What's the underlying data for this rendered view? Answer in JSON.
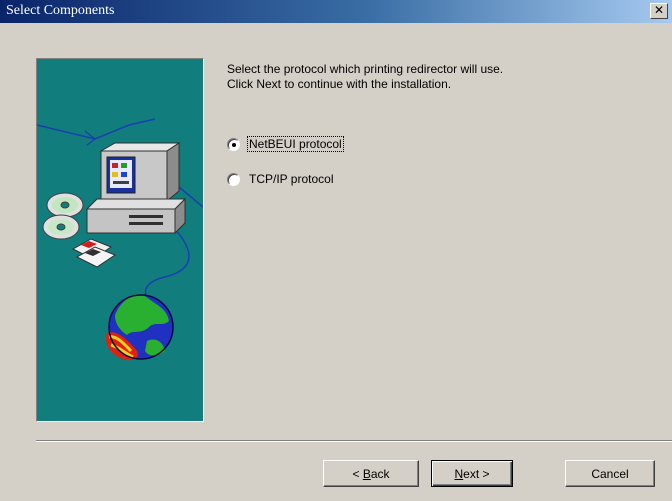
{
  "window": {
    "title": "Select Components",
    "close_glyph": "✕"
  },
  "content": {
    "line1": "Select the protocol which printing redirector will use.",
    "line2": "Click Next to continue with the installation."
  },
  "options": [
    {
      "label": "NetBEUI protocol",
      "selected": true,
      "focused": true
    },
    {
      "label": "TCP/IP protocol",
      "selected": false,
      "focused": false
    }
  ],
  "buttons": {
    "back": {
      "pre": "< ",
      "mnemonic": "B",
      "post": "ack"
    },
    "next": {
      "pre": "",
      "mnemonic": "N",
      "post": "ext >"
    },
    "cancel": "Cancel"
  },
  "colors": {
    "panel_bg": "#117d7d",
    "title_bar": "#0a246a",
    "dialog_face": "#d4d0c8"
  },
  "icons": [
    "close-icon",
    "computer-icon",
    "cd-icon",
    "floppy-icon",
    "globe-icon",
    "radio-selected-icon",
    "radio-unselected-icon"
  ]
}
